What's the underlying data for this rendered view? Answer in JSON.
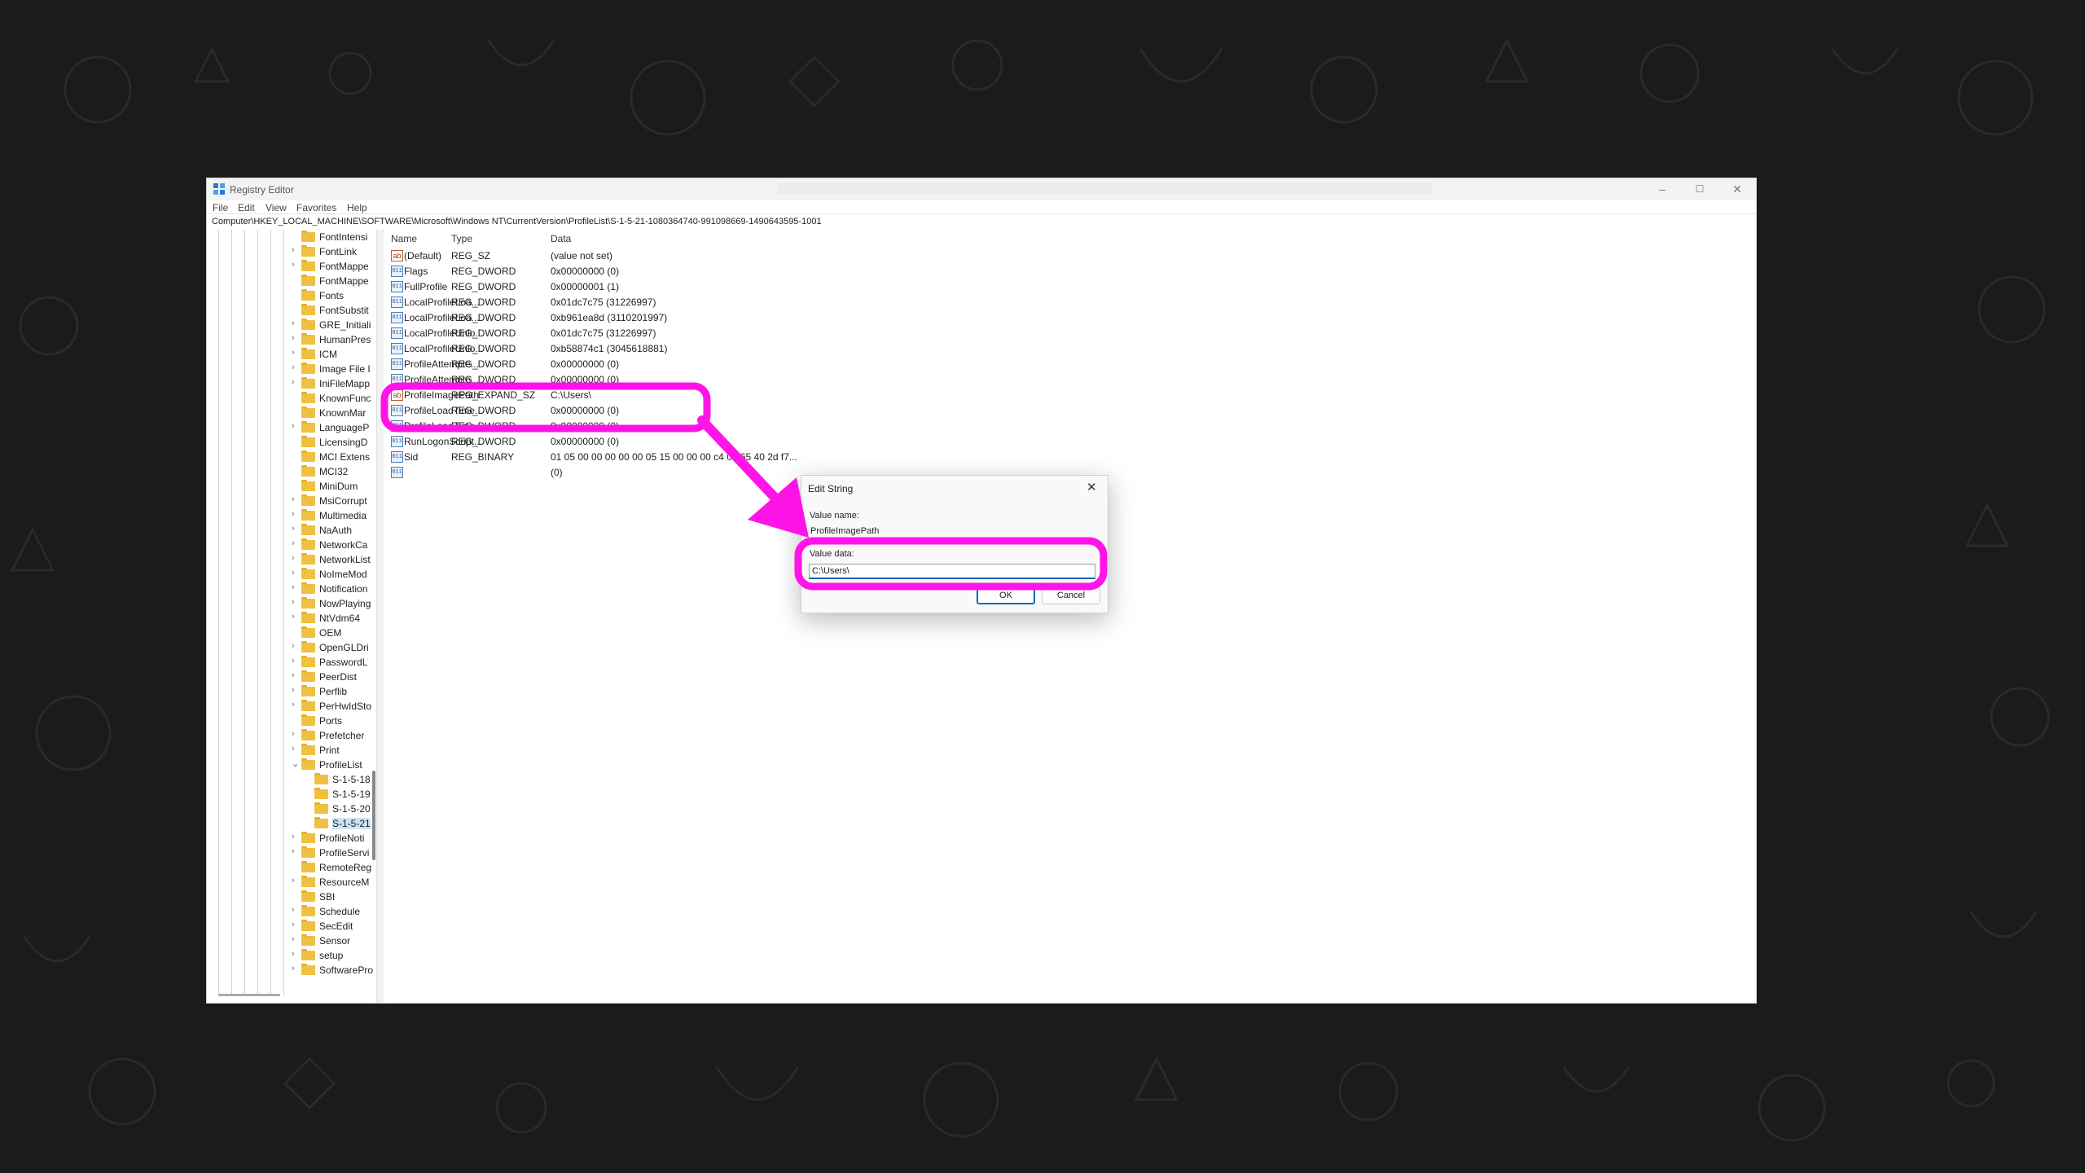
{
  "window": {
    "title": "Registry Editor",
    "minimize": "–",
    "maximize": "☐",
    "close": "✕"
  },
  "menu": [
    "File",
    "Edit",
    "View",
    "Favorites",
    "Help"
  ],
  "address": "Computer\\HKEY_LOCAL_MACHINE\\SOFTWARE\\Microsoft\\Windows NT\\CurrentVersion\\ProfileList\\S-1-5-21-1080364740-991098669-1490643595-1001",
  "tree": [
    {
      "label": "FontIntensi",
      "indent": 0,
      "arrow": ""
    },
    {
      "label": "FontLink",
      "indent": 0,
      "arrow": ">"
    },
    {
      "label": "FontMappe",
      "indent": 0,
      "arrow": ">"
    },
    {
      "label": "FontMappe",
      "indent": 0,
      "arrow": ""
    },
    {
      "label": "Fonts",
      "indent": 0,
      "arrow": ""
    },
    {
      "label": "FontSubstit",
      "indent": 0,
      "arrow": ""
    },
    {
      "label": "GRE_Initiali",
      "indent": 0,
      "arrow": ">"
    },
    {
      "label": "HumanPres",
      "indent": 0,
      "arrow": ">"
    },
    {
      "label": "ICM",
      "indent": 0,
      "arrow": ">"
    },
    {
      "label": "Image File I",
      "indent": 0,
      "arrow": ">"
    },
    {
      "label": "IniFileMapp",
      "indent": 0,
      "arrow": ">"
    },
    {
      "label": "KnownFunc",
      "indent": 0,
      "arrow": ""
    },
    {
      "label": "KnownMar",
      "indent": 0,
      "arrow": ""
    },
    {
      "label": "LanguageP",
      "indent": 0,
      "arrow": ">"
    },
    {
      "label": "LicensingD",
      "indent": 0,
      "arrow": ""
    },
    {
      "label": "MCI Extens",
      "indent": 0,
      "arrow": ""
    },
    {
      "label": "MCI32",
      "indent": 0,
      "arrow": ""
    },
    {
      "label": "MiniDum",
      "indent": 0,
      "arrow": ""
    },
    {
      "label": "MsiCorrupt",
      "indent": 0,
      "arrow": ">"
    },
    {
      "label": "Multimedia",
      "indent": 0,
      "arrow": ">"
    },
    {
      "label": "NaAuth",
      "indent": 0,
      "arrow": ">"
    },
    {
      "label": "NetworkCa",
      "indent": 0,
      "arrow": ">"
    },
    {
      "label": "NetworkList",
      "indent": 0,
      "arrow": ">"
    },
    {
      "label": "NoImeMod",
      "indent": 0,
      "arrow": ">"
    },
    {
      "label": "Notification",
      "indent": 0,
      "arrow": ">"
    },
    {
      "label": "NowPlaying",
      "indent": 0,
      "arrow": ">"
    },
    {
      "label": "NtVdm64",
      "indent": 0,
      "arrow": ">"
    },
    {
      "label": "OEM",
      "indent": 0,
      "arrow": ""
    },
    {
      "label": "OpenGLDri",
      "indent": 0,
      "arrow": ">"
    },
    {
      "label": "PasswordL",
      "indent": 0,
      "arrow": ">"
    },
    {
      "label": "PeerDist",
      "indent": 0,
      "arrow": ">"
    },
    {
      "label": "Perflib",
      "indent": 0,
      "arrow": ">"
    },
    {
      "label": "PerHwIdSto",
      "indent": 0,
      "arrow": ">"
    },
    {
      "label": "Ports",
      "indent": 0,
      "arrow": ""
    },
    {
      "label": "Prefetcher",
      "indent": 0,
      "arrow": ">"
    },
    {
      "label": "Print",
      "indent": 0,
      "arrow": ">"
    },
    {
      "label": "ProfileList",
      "indent": 0,
      "arrow": "v"
    },
    {
      "label": "S-1-5-18",
      "indent": 1,
      "arrow": ""
    },
    {
      "label": "S-1-5-19",
      "indent": 1,
      "arrow": ""
    },
    {
      "label": "S-1-5-20",
      "indent": 1,
      "arrow": ""
    },
    {
      "label": "S-1-5-21",
      "indent": 1,
      "arrow": "",
      "selected": true
    },
    {
      "label": "ProfileNoti",
      "indent": 0,
      "arrow": ">"
    },
    {
      "label": "ProfileServi",
      "indent": 0,
      "arrow": ">"
    },
    {
      "label": "RemoteReg",
      "indent": 0,
      "arrow": ""
    },
    {
      "label": "ResourceM",
      "indent": 0,
      "arrow": ">"
    },
    {
      "label": "SBI",
      "indent": 0,
      "arrow": ""
    },
    {
      "label": "Schedule",
      "indent": 0,
      "arrow": ">"
    },
    {
      "label": "SecEdit",
      "indent": 0,
      "arrow": ">"
    },
    {
      "label": "Sensor",
      "indent": 0,
      "arrow": ">"
    },
    {
      "label": "setup",
      "indent": 0,
      "arrow": ">"
    },
    {
      "label": "SoftwarePro",
      "indent": 0,
      "arrow": ">"
    }
  ],
  "columns": {
    "name": "Name",
    "type": "Type",
    "data": "Data"
  },
  "values": [
    {
      "icon": "ab",
      "name": "(Default)",
      "type": "REG_SZ",
      "data": "(value not set)"
    },
    {
      "icon": "011",
      "name": "Flags",
      "type": "REG_DWORD",
      "data": "0x00000000 (0)"
    },
    {
      "icon": "011",
      "name": "FullProfile",
      "type": "REG_DWORD",
      "data": "0x00000001 (1)"
    },
    {
      "icon": "011",
      "name": "LocalProfileLoa...",
      "type": "REG_DWORD",
      "data": "0x01dc7c75 (31226997)"
    },
    {
      "icon": "011",
      "name": "LocalProfileLoa...",
      "type": "REG_DWORD",
      "data": "0xb961ea8d (3110201997)"
    },
    {
      "icon": "011",
      "name": "LocalProfileUnlo...",
      "type": "REG_DWORD",
      "data": "0x01dc7c75 (31226997)"
    },
    {
      "icon": "011",
      "name": "LocalProfileUnlo...",
      "type": "REG_DWORD",
      "data": "0xb58874c1 (3045618881)"
    },
    {
      "icon": "011",
      "name": "ProfileAttempte...",
      "type": "REG_DWORD",
      "data": "0x00000000 (0)"
    },
    {
      "icon": "011",
      "name": "ProfileAttempte...",
      "type": "REG_DWORD",
      "data": "0x00000000 (0)"
    },
    {
      "icon": "ab",
      "name": "ProfileImagePath",
      "type": "REG_EXPAND_SZ",
      "data": "C:\\Users\\"
    },
    {
      "icon": "011",
      "name": "ProfileLoadTime...",
      "type": "REG_DWORD",
      "data": "0x00000000 (0)"
    },
    {
      "icon": "011",
      "name": "ProfileLoadTime...",
      "type": "REG_DWORD",
      "data": "0x00000000 (0)"
    },
    {
      "icon": "011",
      "name": "RunLogonScript...",
      "type": "REG_DWORD",
      "data": "0x00000000 (0)"
    },
    {
      "icon": "011",
      "name": "Sid",
      "type": "REG_BINARY",
      "data": "01 05 00 00 00 00 00 05 15 00 00 00 c4 0e 65 40 2d f7..."
    },
    {
      "icon": "011",
      "name": "",
      "type": "",
      "data": "(0)"
    }
  ],
  "dialog": {
    "title": "Edit String",
    "close": "✕",
    "value_name_label": "Value name:",
    "value_name": "ProfileImagePath",
    "value_data_label": "Value data:",
    "value_data": "C:\\Users\\",
    "ok": "OK",
    "cancel": "Cancel"
  },
  "annotation": {
    "color": "#ff14e8"
  }
}
